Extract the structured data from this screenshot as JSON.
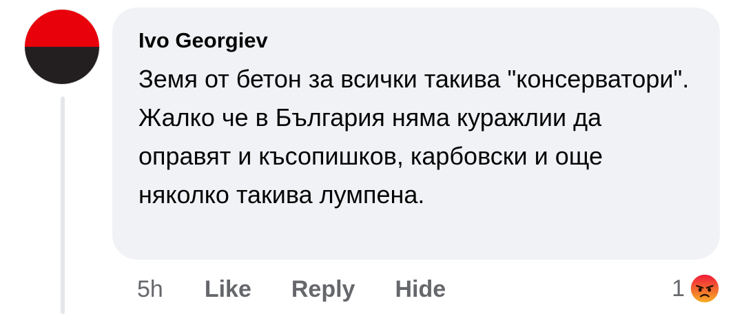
{
  "comment": {
    "author": "Ivo Georgiev",
    "text": "Земя от бетон за всички такива \"консерватори\". Жалко че в България няма куражлии да оправят и късопишков, карбовски и още няколко такива лумпена.",
    "time": "5h",
    "actions": {
      "like_label": "Like",
      "reply_label": "Reply",
      "hide_label": "Hide"
    },
    "reaction": {
      "count": "1",
      "icon": "angry-face-icon"
    }
  },
  "colors": {
    "bubble_bg": "#f0f2f5",
    "author_text": "#050505",
    "body_text": "#050505",
    "meta_text": "#65676b",
    "avatar_top": "#e8000b",
    "avatar_bottom": "#231f20",
    "thread_line": "#e4e6eb",
    "reaction_accent": "#e9710f"
  }
}
